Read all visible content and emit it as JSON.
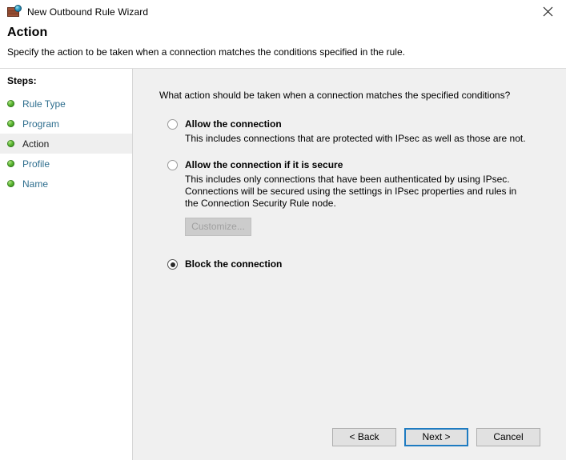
{
  "window": {
    "title": "New Outbound Rule Wizard",
    "icon": "firewall-brick-globe-icon",
    "close_label": "✕"
  },
  "header": {
    "title": "Action",
    "subtitle": "Specify the action to be taken when a connection matches the conditions specified in the rule."
  },
  "sidebar": {
    "title": "Steps:",
    "items": [
      {
        "label": "Rule Type",
        "state": "completed"
      },
      {
        "label": "Program",
        "state": "completed"
      },
      {
        "label": "Action",
        "state": "current"
      },
      {
        "label": "Profile",
        "state": "completed"
      },
      {
        "label": "Name",
        "state": "completed"
      }
    ]
  },
  "main": {
    "question": "What action should be taken when a connection matches the specified conditions?",
    "options": [
      {
        "label": "Allow the connection",
        "description": "This includes connections that are protected with IPsec as well as those are not.",
        "selected": false
      },
      {
        "label": "Allow the connection if it is secure",
        "description": "This includes only connections that have been authenticated by using IPsec.  Connections will be secured using the settings in IPsec properties and rules in the Connection Security Rule node.",
        "selected": false,
        "button": {
          "label": "Customize...",
          "enabled": false
        }
      },
      {
        "label": "Block the connection",
        "description": "",
        "selected": true
      }
    ]
  },
  "footer": {
    "back_label": "< Back",
    "next_label": "Next >",
    "cancel_label": "Cancel"
  },
  "colors": {
    "accent_blue": "#1e7bc1",
    "link_teal": "#2e6e8e",
    "bullet_green": "#5cb733",
    "content_bg": "#f0f0f0"
  }
}
